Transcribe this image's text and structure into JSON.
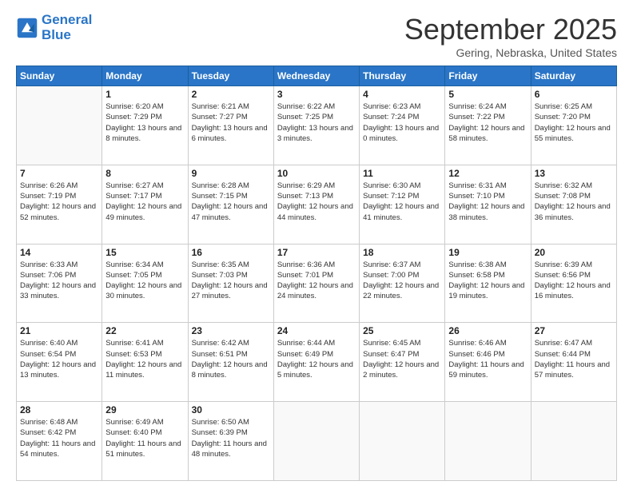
{
  "header": {
    "logo_line1": "General",
    "logo_line2": "Blue",
    "month_title": "September 2025",
    "subtitle": "Gering, Nebraska, United States"
  },
  "days_of_week": [
    "Sunday",
    "Monday",
    "Tuesday",
    "Wednesday",
    "Thursday",
    "Friday",
    "Saturday"
  ],
  "weeks": [
    [
      {
        "day": "",
        "sunrise": "",
        "sunset": "",
        "daylight": ""
      },
      {
        "day": "1",
        "sunrise": "6:20 AM",
        "sunset": "7:29 PM",
        "daylight": "13 hours and 8 minutes."
      },
      {
        "day": "2",
        "sunrise": "6:21 AM",
        "sunset": "7:27 PM",
        "daylight": "13 hours and 6 minutes."
      },
      {
        "day": "3",
        "sunrise": "6:22 AM",
        "sunset": "7:25 PM",
        "daylight": "13 hours and 3 minutes."
      },
      {
        "day": "4",
        "sunrise": "6:23 AM",
        "sunset": "7:24 PM",
        "daylight": "13 hours and 0 minutes."
      },
      {
        "day": "5",
        "sunrise": "6:24 AM",
        "sunset": "7:22 PM",
        "daylight": "12 hours and 58 minutes."
      },
      {
        "day": "6",
        "sunrise": "6:25 AM",
        "sunset": "7:20 PM",
        "daylight": "12 hours and 55 minutes."
      }
    ],
    [
      {
        "day": "7",
        "sunrise": "6:26 AM",
        "sunset": "7:19 PM",
        "daylight": "12 hours and 52 minutes."
      },
      {
        "day": "8",
        "sunrise": "6:27 AM",
        "sunset": "7:17 PM",
        "daylight": "12 hours and 49 minutes."
      },
      {
        "day": "9",
        "sunrise": "6:28 AM",
        "sunset": "7:15 PM",
        "daylight": "12 hours and 47 minutes."
      },
      {
        "day": "10",
        "sunrise": "6:29 AM",
        "sunset": "7:13 PM",
        "daylight": "12 hours and 44 minutes."
      },
      {
        "day": "11",
        "sunrise": "6:30 AM",
        "sunset": "7:12 PM",
        "daylight": "12 hours and 41 minutes."
      },
      {
        "day": "12",
        "sunrise": "6:31 AM",
        "sunset": "7:10 PM",
        "daylight": "12 hours and 38 minutes."
      },
      {
        "day": "13",
        "sunrise": "6:32 AM",
        "sunset": "7:08 PM",
        "daylight": "12 hours and 36 minutes."
      }
    ],
    [
      {
        "day": "14",
        "sunrise": "6:33 AM",
        "sunset": "7:06 PM",
        "daylight": "12 hours and 33 minutes."
      },
      {
        "day": "15",
        "sunrise": "6:34 AM",
        "sunset": "7:05 PM",
        "daylight": "12 hours and 30 minutes."
      },
      {
        "day": "16",
        "sunrise": "6:35 AM",
        "sunset": "7:03 PM",
        "daylight": "12 hours and 27 minutes."
      },
      {
        "day": "17",
        "sunrise": "6:36 AM",
        "sunset": "7:01 PM",
        "daylight": "12 hours and 24 minutes."
      },
      {
        "day": "18",
        "sunrise": "6:37 AM",
        "sunset": "7:00 PM",
        "daylight": "12 hours and 22 minutes."
      },
      {
        "day": "19",
        "sunrise": "6:38 AM",
        "sunset": "6:58 PM",
        "daylight": "12 hours and 19 minutes."
      },
      {
        "day": "20",
        "sunrise": "6:39 AM",
        "sunset": "6:56 PM",
        "daylight": "12 hours and 16 minutes."
      }
    ],
    [
      {
        "day": "21",
        "sunrise": "6:40 AM",
        "sunset": "6:54 PM",
        "daylight": "12 hours and 13 minutes."
      },
      {
        "day": "22",
        "sunrise": "6:41 AM",
        "sunset": "6:53 PM",
        "daylight": "12 hours and 11 minutes."
      },
      {
        "day": "23",
        "sunrise": "6:42 AM",
        "sunset": "6:51 PM",
        "daylight": "12 hours and 8 minutes."
      },
      {
        "day": "24",
        "sunrise": "6:44 AM",
        "sunset": "6:49 PM",
        "daylight": "12 hours and 5 minutes."
      },
      {
        "day": "25",
        "sunrise": "6:45 AM",
        "sunset": "6:47 PM",
        "daylight": "12 hours and 2 minutes."
      },
      {
        "day": "26",
        "sunrise": "6:46 AM",
        "sunset": "6:46 PM",
        "daylight": "11 hours and 59 minutes."
      },
      {
        "day": "27",
        "sunrise": "6:47 AM",
        "sunset": "6:44 PM",
        "daylight": "11 hours and 57 minutes."
      }
    ],
    [
      {
        "day": "28",
        "sunrise": "6:48 AM",
        "sunset": "6:42 PM",
        "daylight": "11 hours and 54 minutes."
      },
      {
        "day": "29",
        "sunrise": "6:49 AM",
        "sunset": "6:40 PM",
        "daylight": "11 hours and 51 minutes."
      },
      {
        "day": "30",
        "sunrise": "6:50 AM",
        "sunset": "6:39 PM",
        "daylight": "11 hours and 48 minutes."
      },
      {
        "day": "",
        "sunrise": "",
        "sunset": "",
        "daylight": ""
      },
      {
        "day": "",
        "sunrise": "",
        "sunset": "",
        "daylight": ""
      },
      {
        "day": "",
        "sunrise": "",
        "sunset": "",
        "daylight": ""
      },
      {
        "day": "",
        "sunrise": "",
        "sunset": "",
        "daylight": ""
      }
    ]
  ],
  "labels": {
    "sunrise": "Sunrise:",
    "sunset": "Sunset:",
    "daylight": "Daylight:"
  }
}
